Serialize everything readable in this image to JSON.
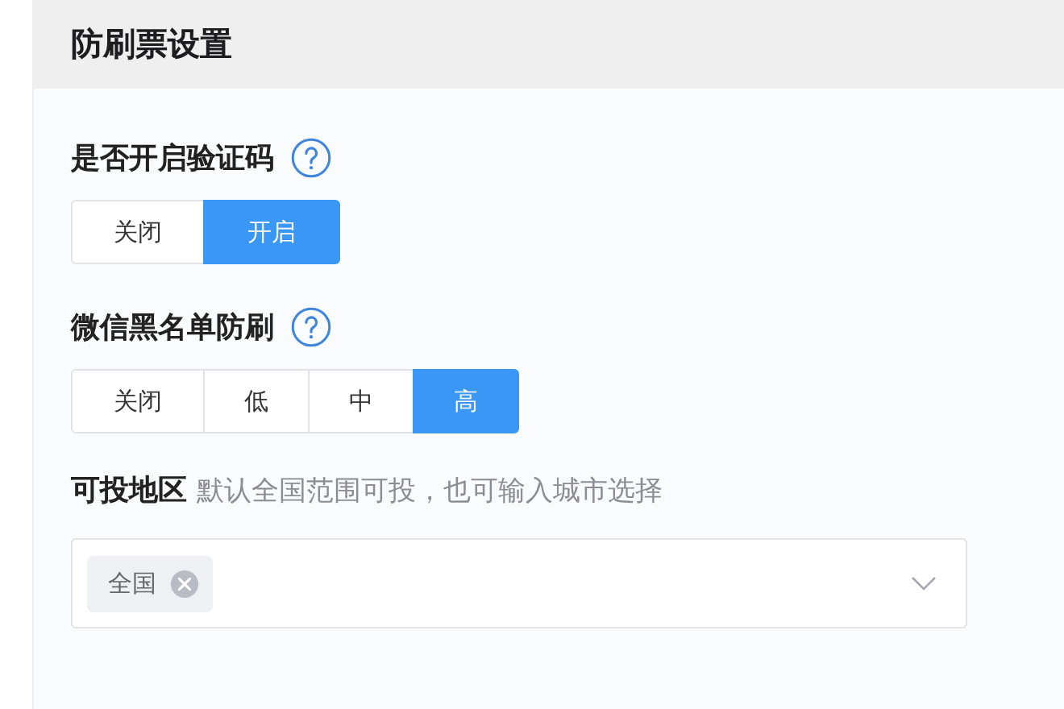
{
  "section": {
    "title": "防刷票设置"
  },
  "settings": [
    {
      "label": "是否开启验证码",
      "help": true,
      "options": [
        {
          "label": "关闭",
          "selected": false
        },
        {
          "label": "开启",
          "selected": true
        }
      ]
    },
    {
      "label": "微信黑名单防刷",
      "help": true,
      "options": [
        {
          "label": "关闭",
          "selected": false
        },
        {
          "label": "低",
          "selected": false
        },
        {
          "label": "中",
          "selected": false
        },
        {
          "label": "高",
          "selected": true
        }
      ]
    }
  ],
  "region": {
    "label": "可投地区",
    "hint": "默认全国范围可投，也可输入城市选择",
    "tags": [
      {
        "label": "全国"
      }
    ]
  }
}
